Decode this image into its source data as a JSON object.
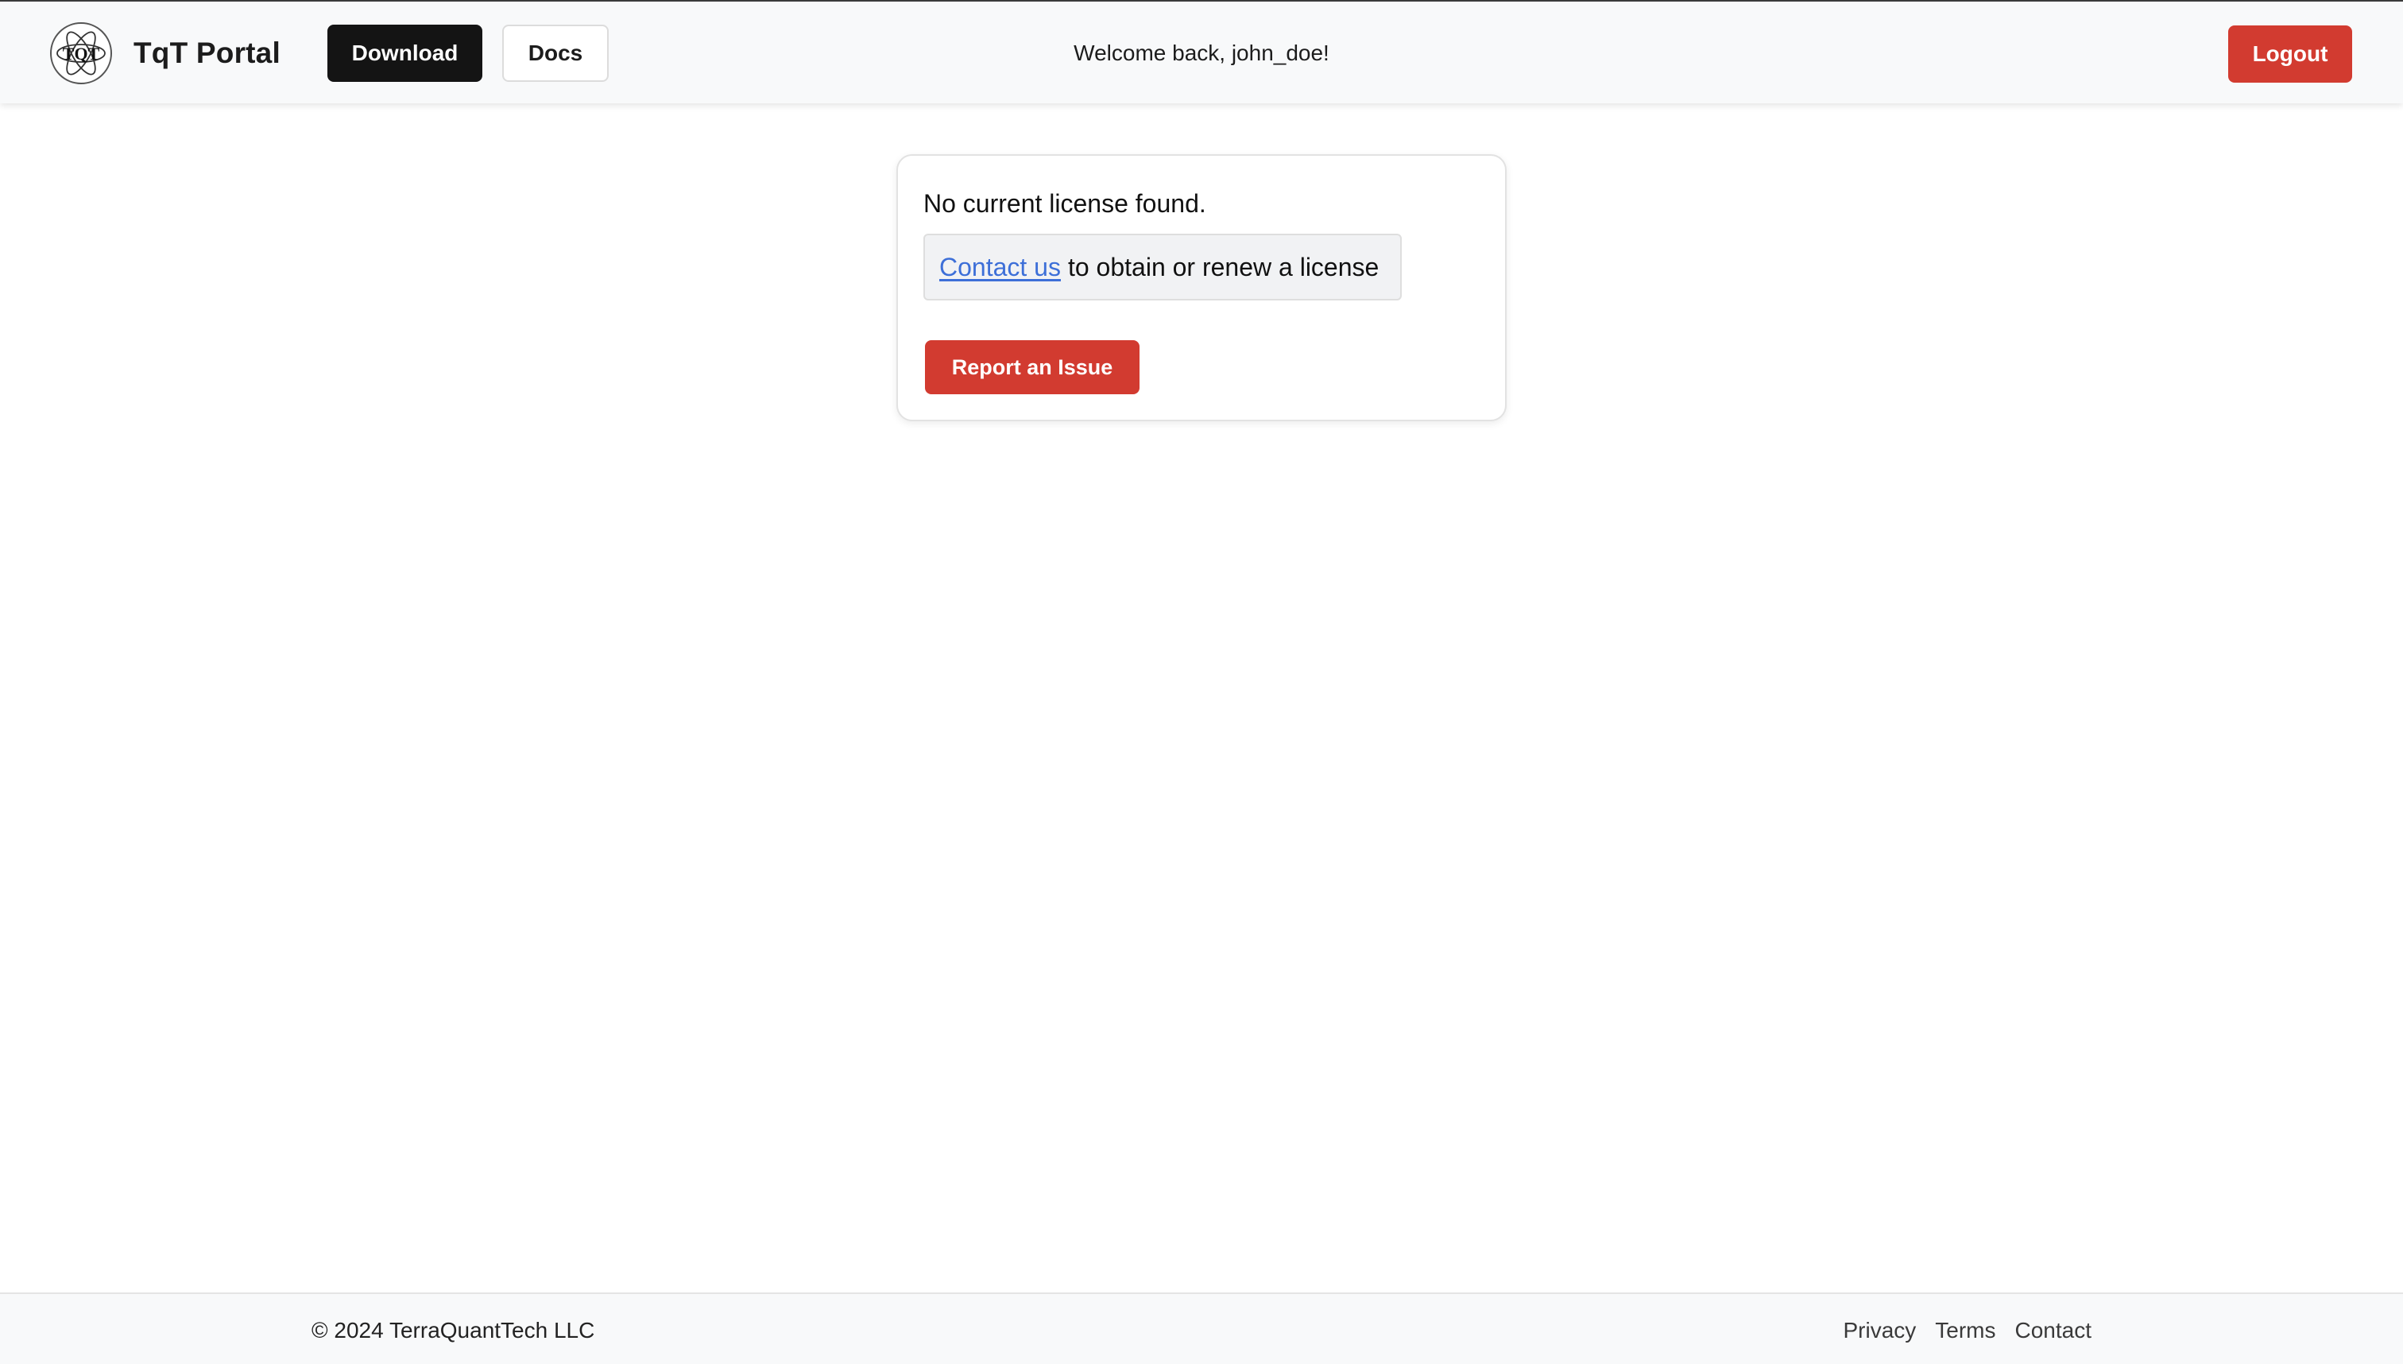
{
  "header": {
    "brand": "TqT Portal",
    "logo_text": "TQT",
    "logo_icon": "atom-logo-icon",
    "download_label": "Download",
    "docs_label": "Docs",
    "welcome": "Welcome back, john_doe!",
    "logout_label": "Logout"
  },
  "license_card": {
    "message": "No current license found.",
    "contact_link": "Contact us",
    "contact_rest": "to obtain or renew a license",
    "report_label": "Report an Issue"
  },
  "footer": {
    "copyright": "© 2024 TerraQuantTech LLC",
    "links": [
      "Privacy",
      "Terms",
      "Contact"
    ]
  },
  "colors": {
    "accent_red": "#d23b30",
    "dark_button": "#141414",
    "link_blue": "#3d6fd8",
    "bar_background": "#f8f9fa"
  }
}
